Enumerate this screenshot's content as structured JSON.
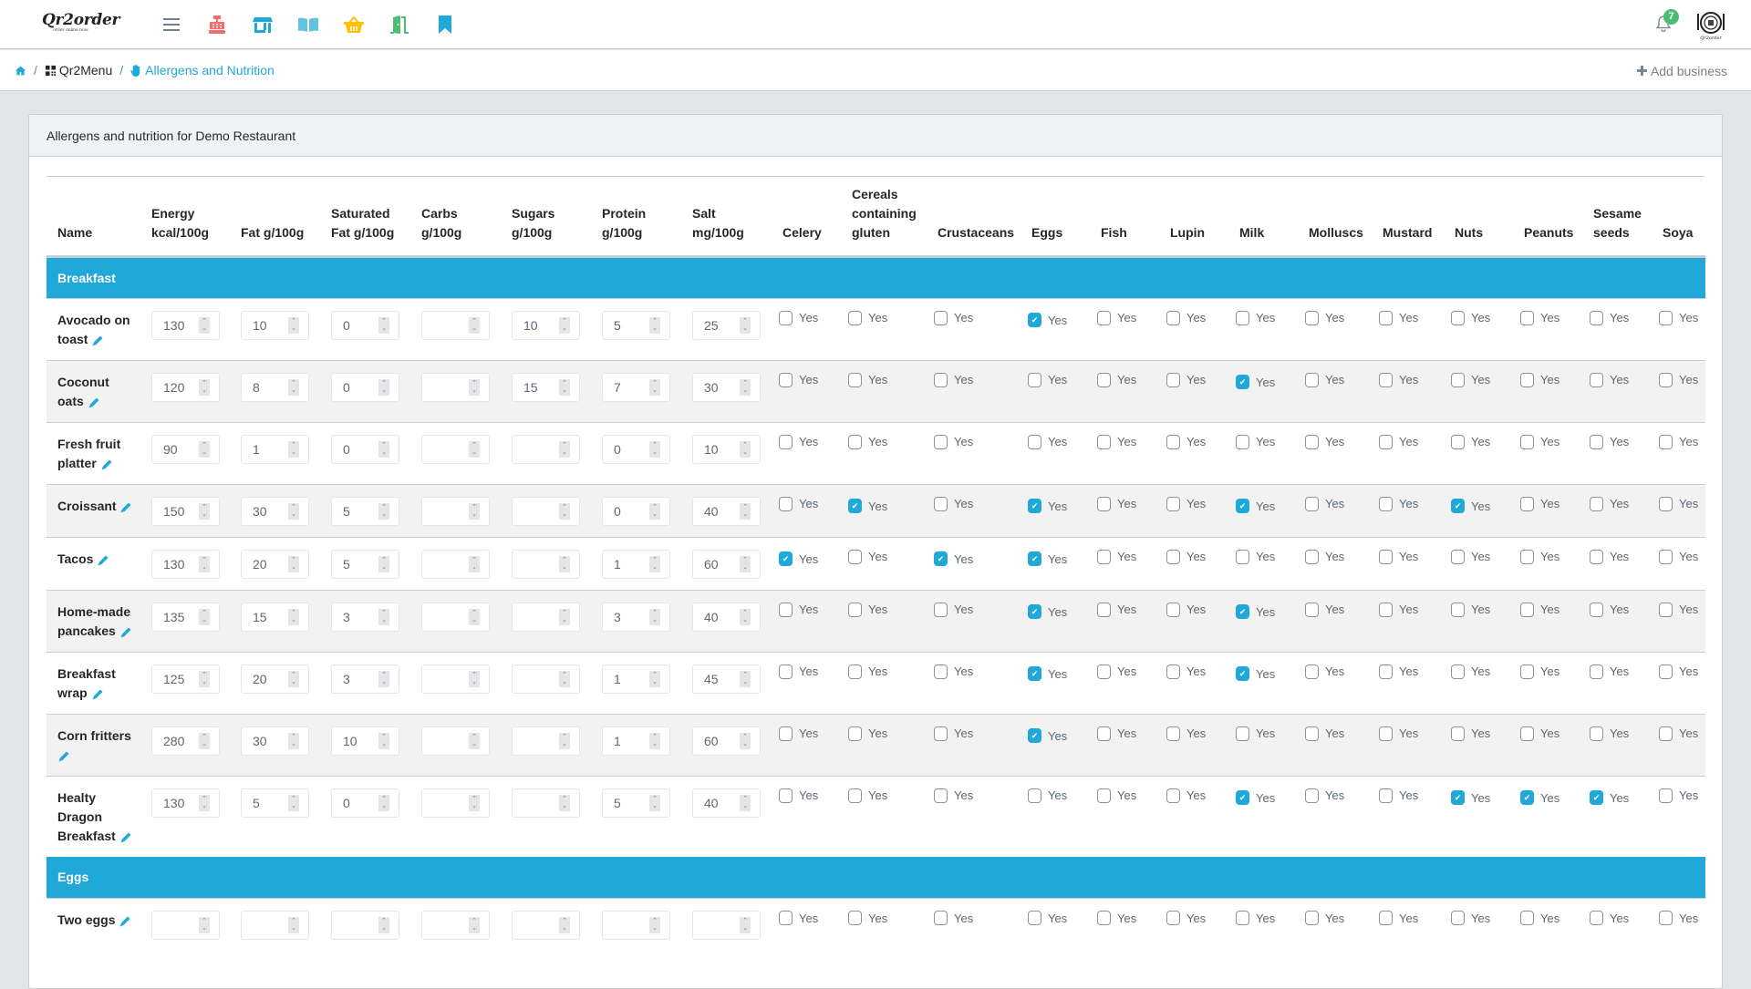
{
  "navbar": {
    "logo_text": "Qr2order",
    "logo_tagline": "order online now",
    "icons": [
      {
        "name": "menu-toggle-icon",
        "color": "#73818f"
      },
      {
        "name": "cash-register-icon",
        "color": "#f86c6b"
      },
      {
        "name": "store-icon",
        "color": "#20a8d8"
      },
      {
        "name": "book-open-icon",
        "color": "#63c2de"
      },
      {
        "name": "basket-icon",
        "color": "#ffc107"
      },
      {
        "name": "door-open-icon",
        "color": "#4dbd74"
      },
      {
        "name": "bookmark-icon",
        "color": "#20a8d8"
      }
    ],
    "notification_count": "7"
  },
  "breadcrumb": {
    "items": [
      {
        "label": "",
        "icon": "home-icon"
      },
      {
        "label": "Qr2Menu",
        "icon": "qrcode-icon"
      },
      {
        "label": "Allergens and Nutrition",
        "icon": "hand-icon"
      }
    ],
    "action": "Add business"
  },
  "card": {
    "title": "Allergens and nutrition for Demo Restaurant"
  },
  "table": {
    "columns": [
      "Name",
      "Energy kcal/100g",
      "Fat g/100g",
      "Saturated Fat g/100g",
      "Carbs g/100g",
      "Sugars g/100g",
      "Protein g/100g",
      "Salt mg/100g",
      "Celery",
      "Cereals containing gluten",
      "Crustaceans",
      "Eggs",
      "Fish",
      "Lupin",
      "Milk",
      "Molluscs",
      "Mustard",
      "Nuts",
      "Peanuts",
      "Sesame seeds",
      "Soya"
    ],
    "checkbox_label": "Yes",
    "groups": [
      {
        "name": "Breakfast",
        "items": [
          {
            "name": "Avocado on toast",
            "nutrition": [
              "130",
              "10",
              "0",
              "",
              "10",
              "5",
              "25"
            ],
            "allergens": [
              "Eggs"
            ]
          },
          {
            "name": "Coconut oats",
            "nutrition": [
              "120",
              "8",
              "0",
              "",
              "15",
              "7",
              "30"
            ],
            "allergens": [
              "Milk"
            ]
          },
          {
            "name": "Fresh fruit platter",
            "nutrition": [
              "90",
              "1",
              "0",
              "",
              "",
              "0",
              "10"
            ],
            "allergens": []
          },
          {
            "name": "Croissant",
            "nutrition": [
              "150",
              "30",
              "5",
              "",
              "",
              "0",
              "40"
            ],
            "allergens": [
              "Cereals containing gluten",
              "Eggs",
              "Milk",
              "Nuts"
            ]
          },
          {
            "name": "Tacos",
            "nutrition": [
              "130",
              "20",
              "5",
              "",
              "",
              "1",
              "60"
            ],
            "allergens": [
              "Celery",
              "Crustaceans",
              "Eggs"
            ]
          },
          {
            "name": "Home-made pancakes",
            "nutrition": [
              "135",
              "15",
              "3",
              "",
              "",
              "3",
              "40"
            ],
            "allergens": [
              "Eggs",
              "Milk"
            ]
          },
          {
            "name": "Breakfast wrap",
            "nutrition": [
              "125",
              "20",
              "3",
              "",
              "",
              "1",
              "45"
            ],
            "allergens": [
              "Eggs",
              "Milk"
            ]
          },
          {
            "name": "Corn fritters",
            "nutrition": [
              "280",
              "30",
              "10",
              "",
              "",
              "1",
              "60"
            ],
            "allergens": [
              "Eggs"
            ]
          },
          {
            "name": "Healty Dragon Breakfast",
            "nutrition": [
              "130",
              "5",
              "0",
              "",
              "",
              "5",
              "40"
            ],
            "allergens": [
              "Milk",
              "Nuts",
              "Peanuts",
              "Sesame seeds"
            ]
          }
        ]
      },
      {
        "name": "Eggs",
        "items": [
          {
            "name": "Two eggs",
            "nutrition": [
              "",
              "",
              "",
              "",
              "",
              "",
              ""
            ],
            "allergens": []
          }
        ]
      }
    ]
  },
  "colors": {
    "accent": "#20a8d8",
    "success": "#4dbd74",
    "danger": "#f86c6b",
    "warning": "#ffc107"
  }
}
